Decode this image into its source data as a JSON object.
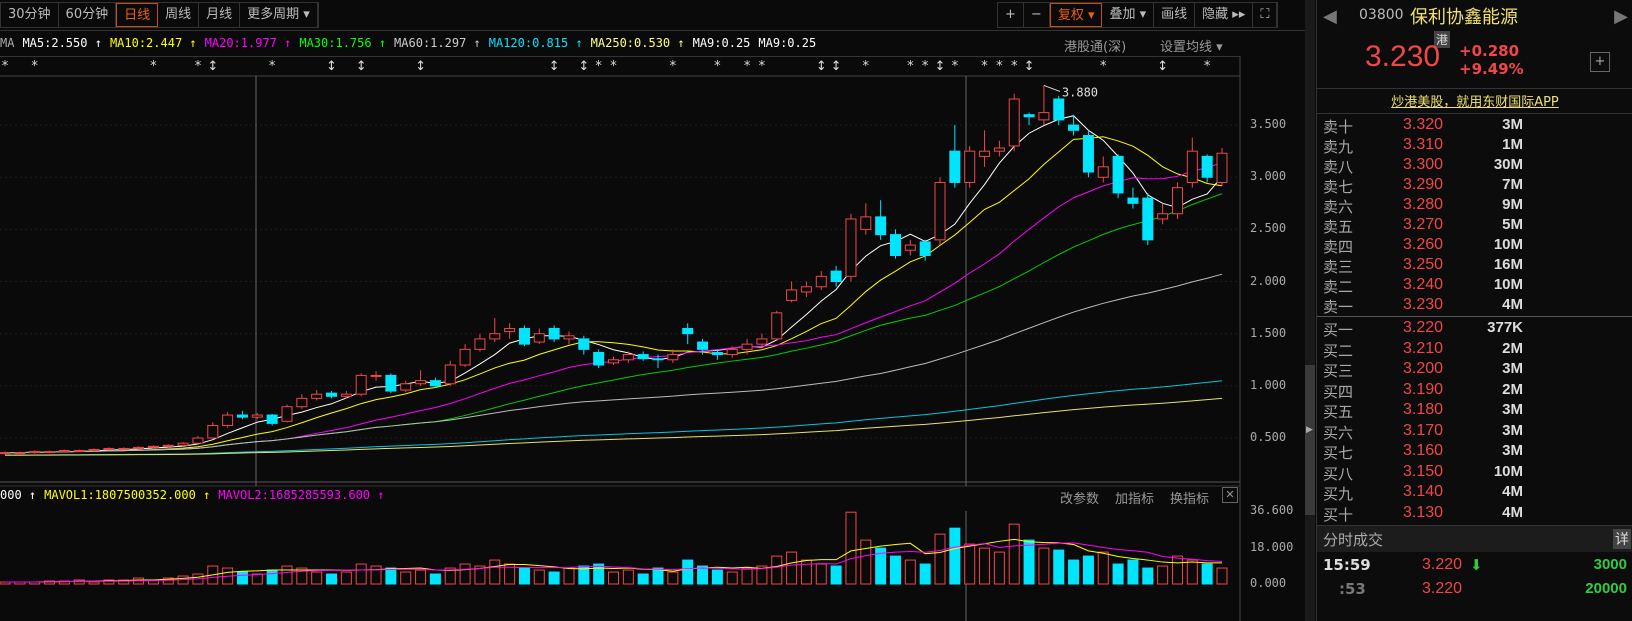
{
  "toolbar_left": [
    "30分钟",
    "60分钟",
    "日线",
    "周线",
    "月线",
    "更多周期 ▾"
  ],
  "active_period": "日线",
  "toolbar_right": {
    "plus": "+",
    "minus": "−",
    "fuquan": "复权 ▾",
    "overlay": "叠加 ▾",
    "draw": "画线",
    "hide": "隐藏 ▸▸"
  },
  "ma_legend": [
    {
      "t": "MA",
      "c": "#aaaaaa"
    },
    {
      "t": "MA5:2.550 ↑",
      "c": "#ffffff"
    },
    {
      "t": "MA10:2.447 ↑",
      "c": "#ffff00"
    },
    {
      "t": "MA20:1.977 ↑",
      "c": "#ff00ff"
    },
    {
      "t": "MA30:1.756 ↑",
      "c": "#00ff00"
    },
    {
      "t": "MA60:1.297 ↑",
      "c": "#cccccc"
    },
    {
      "t": "MA120:0.815 ↑",
      "c": "#00e5ff"
    },
    {
      "t": "MA250:0.530 ↑",
      "c": "#ffff88"
    },
    {
      "t": "MA9:0.25",
      "c": "#ffffff"
    },
    {
      "t": "MA9:0.25",
      "c": "#ffffff"
    }
  ],
  "chart_links": {
    "hk_connect": "港股通(深)",
    "set_ma": "设置均线 ▾"
  },
  "price_axis": [
    "3.500",
    "3.000",
    "2.500",
    "2.000",
    "1.500",
    "1.000",
    "0.500"
  ],
  "max_label": "3.880",
  "vol_legend": [
    {
      "t": "000 ↑",
      "c": "#ffffff"
    },
    {
      "t": "MAVOL1:1807500352.000 ↑",
      "c": "#ffff00"
    },
    {
      "t": "MAVOL2:1685285593.600 ↑",
      "c": "#ff00ff"
    }
  ],
  "vol_links": {
    "params": "改参数",
    "add": "加指标",
    "switch": "换指标",
    "close": "✕"
  },
  "vol_axis": [
    "36.600",
    "18.000",
    "0.000"
  ],
  "colors": {
    "up": "#f0464a",
    "down": "#00e5ff"
  },
  "candles": [
    [
      0.35,
      0.36,
      0.37,
      0.34
    ],
    [
      0.36,
      0.36,
      0.37,
      0.35
    ],
    [
      0.36,
      0.37,
      0.38,
      0.35
    ],
    [
      0.37,
      0.37,
      0.38,
      0.36
    ],
    [
      0.37,
      0.38,
      0.39,
      0.36
    ],
    [
      0.38,
      0.38,
      0.39,
      0.37
    ],
    [
      0.38,
      0.39,
      0.4,
      0.37
    ],
    [
      0.39,
      0.4,
      0.41,
      0.38
    ],
    [
      0.4,
      0.4,
      0.41,
      0.39
    ],
    [
      0.4,
      0.41,
      0.42,
      0.39
    ],
    [
      0.41,
      0.42,
      0.43,
      0.4
    ],
    [
      0.42,
      0.43,
      0.44,
      0.41
    ],
    [
      0.43,
      0.45,
      0.46,
      0.42
    ],
    [
      0.45,
      0.5,
      0.52,
      0.44
    ],
    [
      0.5,
      0.62,
      0.65,
      0.49
    ],
    [
      0.62,
      0.72,
      0.75,
      0.6
    ],
    [
      0.72,
      0.7,
      0.76,
      0.68
    ],
    [
      0.7,
      0.72,
      0.74,
      0.68
    ],
    [
      0.72,
      0.64,
      0.73,
      0.62
    ],
    [
      0.66,
      0.8,
      0.82,
      0.65
    ],
    [
      0.8,
      0.88,
      0.92,
      0.78
    ],
    [
      0.88,
      0.92,
      0.96,
      0.86
    ],
    [
      0.93,
      0.9,
      0.95,
      0.88
    ],
    [
      0.9,
      0.92,
      0.95,
      0.88
    ],
    [
      0.92,
      1.1,
      1.12,
      0.9
    ],
    [
      1.1,
      1.1,
      1.14,
      1.05
    ],
    [
      1.1,
      0.95,
      1.12,
      0.93
    ],
    [
      0.96,
      1.02,
      1.05,
      0.94
    ],
    [
      1.02,
      1.05,
      1.15,
      1.0
    ],
    [
      1.05,
      1.0,
      1.08,
      0.98
    ],
    [
      1.02,
      1.2,
      1.24,
      1.0
    ],
    [
      1.2,
      1.35,
      1.4,
      1.18
    ],
    [
      1.35,
      1.45,
      1.5,
      1.33
    ],
    [
      1.45,
      1.5,
      1.65,
      1.42
    ],
    [
      1.52,
      1.55,
      1.6,
      1.45
    ],
    [
      1.55,
      1.4,
      1.58,
      1.38
    ],
    [
      1.42,
      1.5,
      1.55,
      1.4
    ],
    [
      1.55,
      1.45,
      1.58,
      1.42
    ],
    [
      1.45,
      1.48,
      1.52,
      1.4
    ],
    [
      1.45,
      1.35,
      1.48,
      1.3
    ],
    [
      1.32,
      1.2,
      1.35,
      1.17
    ],
    [
      1.22,
      1.25,
      1.28,
      1.2
    ],
    [
      1.25,
      1.3,
      1.33,
      1.22
    ],
    [
      1.3,
      1.26,
      1.33,
      1.24
    ],
    [
      1.26,
      1.25,
      1.3,
      1.17
    ],
    [
      1.25,
      1.3,
      1.35,
      1.22
    ],
    [
      1.55,
      1.5,
      1.6,
      1.4
    ],
    [
      1.42,
      1.35,
      1.45,
      1.3
    ],
    [
      1.32,
      1.3,
      1.35,
      1.25
    ],
    [
      1.3,
      1.35,
      1.38,
      1.27
    ],
    [
      1.35,
      1.4,
      1.45,
      1.3
    ],
    [
      1.4,
      1.45,
      1.5,
      1.37
    ],
    [
      1.45,
      1.7,
      1.72,
      1.43
    ],
    [
      1.82,
      1.92,
      2.0,
      1.8
    ],
    [
      1.9,
      1.95,
      2.0,
      1.85
    ],
    [
      1.95,
      2.05,
      2.1,
      1.92
    ],
    [
      2.1,
      2.0,
      2.15,
      1.95
    ],
    [
      2.05,
      2.6,
      2.65,
      2.0
    ],
    [
      2.5,
      2.62,
      2.75,
      2.45
    ],
    [
      2.62,
      2.45,
      2.78,
      2.4
    ],
    [
      2.45,
      2.25,
      2.5,
      2.22
    ],
    [
      2.3,
      2.35,
      2.4,
      2.25
    ],
    [
      2.38,
      2.25,
      2.4,
      2.2
    ],
    [
      2.4,
      2.95,
      3.0,
      2.35
    ],
    [
      3.25,
      2.95,
      3.5,
      2.9
    ],
    [
      2.95,
      3.25,
      3.3,
      2.9
    ],
    [
      3.2,
      3.25,
      3.45,
      3.1
    ],
    [
      3.25,
      3.28,
      3.35,
      3.2
    ],
    [
      3.3,
      3.75,
      3.8,
      3.25
    ],
    [
      3.6,
      3.58,
      3.62,
      3.5
    ],
    [
      3.55,
      3.62,
      3.88,
      3.5
    ],
    [
      3.75,
      3.55,
      3.78,
      3.5
    ],
    [
      3.5,
      3.45,
      3.6,
      3.4
    ],
    [
      3.4,
      3.05,
      3.45,
      3.0
    ],
    [
      3.0,
      3.1,
      3.2,
      2.95
    ],
    [
      3.2,
      2.85,
      3.22,
      2.8
    ],
    [
      2.8,
      2.75,
      2.9,
      2.7
    ],
    [
      2.8,
      2.4,
      2.85,
      2.35
    ],
    [
      2.6,
      2.65,
      2.75,
      2.55
    ],
    [
      2.65,
      2.9,
      2.95,
      2.6
    ],
    [
      2.95,
      3.25,
      3.38,
      2.9
    ],
    [
      3.2,
      3.0,
      3.22,
      2.95
    ],
    [
      2.95,
      3.23,
      3.28,
      2.92
    ]
  ],
  "volumes": [
    1,
    1,
    1,
    1.5,
    1.5,
    2,
    1,
    2,
    2,
    3,
    2,
    3,
    4,
    5,
    9,
    8,
    6,
    5,
    7,
    9,
    8,
    6,
    5,
    6,
    10,
    9,
    8,
    6,
    7,
    5,
    8,
    10,
    9,
    12,
    10,
    8,
    7,
    6,
    8,
    9,
    10,
    6,
    7,
    5,
    8,
    6,
    12,
    9,
    7,
    6,
    8,
    9,
    14,
    16,
    12,
    10,
    9,
    36,
    22,
    18,
    14,
    12,
    10,
    25,
    28,
    20,
    18,
    16,
    30,
    22,
    18,
    17,
    12,
    14,
    16,
    10,
    12,
    8,
    9,
    14,
    12,
    10,
    8
  ],
  "markers": [
    [
      0,
      "*"
    ],
    [
      2,
      "*"
    ],
    [
      10,
      "*"
    ],
    [
      13,
      "*"
    ],
    [
      14,
      "↕"
    ],
    [
      18,
      "*"
    ],
    [
      22,
      "↕"
    ],
    [
      24,
      "↕"
    ],
    [
      28,
      "↕"
    ],
    [
      37,
      "↕"
    ],
    [
      39,
      "↕"
    ],
    [
      40,
      "*"
    ],
    [
      41,
      "*"
    ],
    [
      45,
      "*"
    ],
    [
      48,
      "*"
    ],
    [
      50,
      "*"
    ],
    [
      51,
      "*"
    ],
    [
      55,
      "↕"
    ],
    [
      56,
      "↕"
    ],
    [
      58,
      "*"
    ],
    [
      61,
      "*"
    ],
    [
      62,
      "*"
    ],
    [
      63,
      "↕"
    ],
    [
      64,
      "*"
    ],
    [
      66,
      "*"
    ],
    [
      67,
      "*"
    ],
    [
      68,
      "*"
    ],
    [
      69,
      "↕"
    ],
    [
      74,
      "*"
    ],
    [
      78,
      "↕"
    ],
    [
      81,
      "*"
    ]
  ],
  "stock": {
    "code": "03800",
    "name": "保利协鑫能源",
    "badge": "港",
    "price": "3.230",
    "change": "+0.280",
    "pct": "+9.49%",
    "ad": "炒港美股，就用东财国际APP"
  },
  "asks": [
    {
      "n": "卖十",
      "p": "3.320",
      "v": "3M"
    },
    {
      "n": "卖九",
      "p": "3.310",
      "v": "1M"
    },
    {
      "n": "卖八",
      "p": "3.300",
      "v": "30M"
    },
    {
      "n": "卖七",
      "p": "3.290",
      "v": "7M"
    },
    {
      "n": "卖六",
      "p": "3.280",
      "v": "9M"
    },
    {
      "n": "卖五",
      "p": "3.270",
      "v": "5M"
    },
    {
      "n": "卖四",
      "p": "3.260",
      "v": "10M"
    },
    {
      "n": "卖三",
      "p": "3.250",
      "v": "16M"
    },
    {
      "n": "卖二",
      "p": "3.240",
      "v": "10M"
    },
    {
      "n": "卖一",
      "p": "3.230",
      "v": "4M"
    }
  ],
  "bids": [
    {
      "n": "买一",
      "p": "3.220",
      "v": "377K"
    },
    {
      "n": "买二",
      "p": "3.210",
      "v": "2M"
    },
    {
      "n": "买三",
      "p": "3.200",
      "v": "3M"
    },
    {
      "n": "买四",
      "p": "3.190",
      "v": "2M"
    },
    {
      "n": "买五",
      "p": "3.180",
      "v": "3M"
    },
    {
      "n": "买六",
      "p": "3.170",
      "v": "3M"
    },
    {
      "n": "买七",
      "p": "3.160",
      "v": "3M"
    },
    {
      "n": "买八",
      "p": "3.150",
      "v": "10M"
    },
    {
      "n": "买九",
      "p": "3.140",
      "v": "4M"
    },
    {
      "n": "买十",
      "p": "3.130",
      "v": "4M"
    }
  ],
  "ticks_title": "分时成交",
  "ticks_detail": "详",
  "ticks": [
    {
      "t": "15:59",
      "p": "3.220",
      "arrow": "⬇",
      "v": "3000"
    },
    {
      "t": ":53",
      "p": "3.220",
      "arrow": "",
      "v": "20000"
    }
  ]
}
